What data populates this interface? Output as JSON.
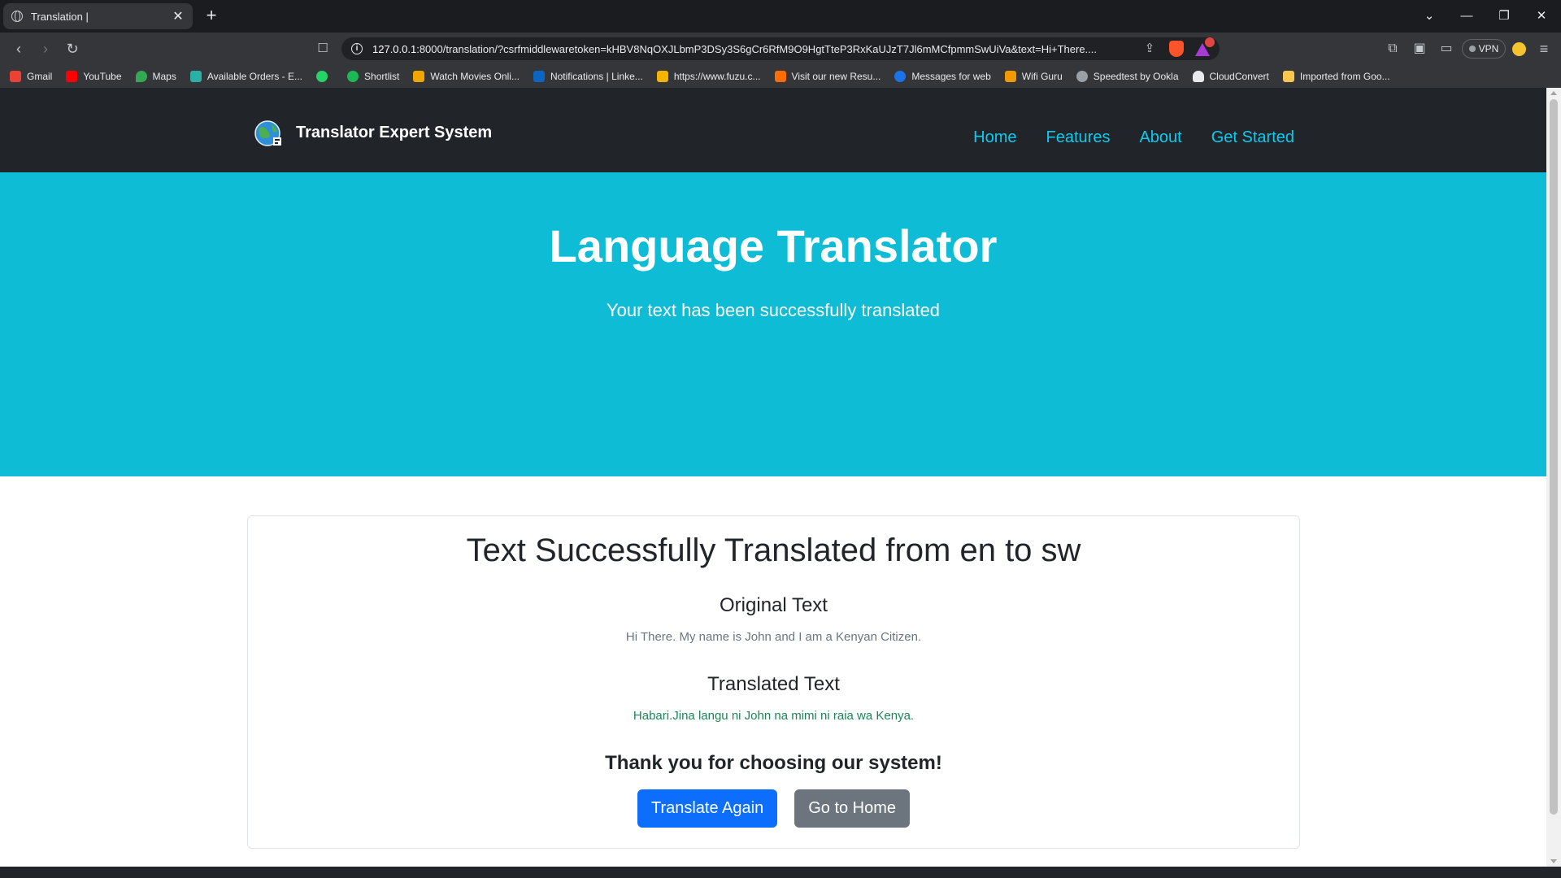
{
  "browser": {
    "tab_title": "Translation |",
    "url_host": "127.0.0.1",
    "url_rest": ":8000/translation/?csrfmiddlewaretoken=kHBV8NqOXJLbmP3DSy3S6gCr6RfM9O9HgtTteP3RxKaUJzT7Jl6mMCfpmmSwUiVa&text=Hi+There....",
    "vpn_label": "VPN",
    "rewards_badge": "",
    "bookmarks": [
      {
        "label": "Gmail",
        "color": "#ea4335"
      },
      {
        "label": "YouTube",
        "color": "#ff0000"
      },
      {
        "label": "Maps",
        "color": "#34a853"
      },
      {
        "label": "Available Orders - E...",
        "color": "#2bb0a8"
      },
      {
        "label": "",
        "color": "#25d366"
      },
      {
        "label": "Shortlist",
        "color": "#1db954"
      },
      {
        "label": "Watch Movies Onli...",
        "color": "#f0a500"
      },
      {
        "label": "Notifications | Linke...",
        "color": "#0a66c2"
      },
      {
        "label": "https://www.fuzu.c...",
        "color": "#f4b400"
      },
      {
        "label": "Visit our new Resu...",
        "color": "#ff6d00"
      },
      {
        "label": "Messages for web",
        "color": "#1a73e8"
      },
      {
        "label": "Wifi Guru",
        "color": "#f29900"
      },
      {
        "label": "Speedtest by Ookla",
        "color": "#9aa0a6"
      },
      {
        "label": "CloudConvert",
        "color": "#e8eaed"
      },
      {
        "label": "Imported from Goo...",
        "color": "#f9c74f"
      }
    ]
  },
  "navbar": {
    "brand": "Translator Expert System",
    "links": [
      "Home",
      "Features",
      "About",
      "Get Started"
    ]
  },
  "hero": {
    "title": "Language Translator",
    "subtitle": "Your text has been successfully translated"
  },
  "result": {
    "heading": "Text Successfully Translated from en to sw",
    "original_heading": "Original Text",
    "original_text": "Hi There. My name is John and I am a Kenyan Citizen.",
    "translated_heading": "Translated Text",
    "translated_text": "Habari.Jina langu ni John na mimi ni raia wa Kenya.",
    "thanks": "Thank you for choosing our system!",
    "translate_again": "Translate Again",
    "go_home": "Go to Home"
  },
  "colors": {
    "navbar": "#212529",
    "hero": "#0fbcd6",
    "link": "#0dcaf0",
    "primary": "#0d6efd",
    "secondary": "#6c757d",
    "success_text": "#198754"
  }
}
